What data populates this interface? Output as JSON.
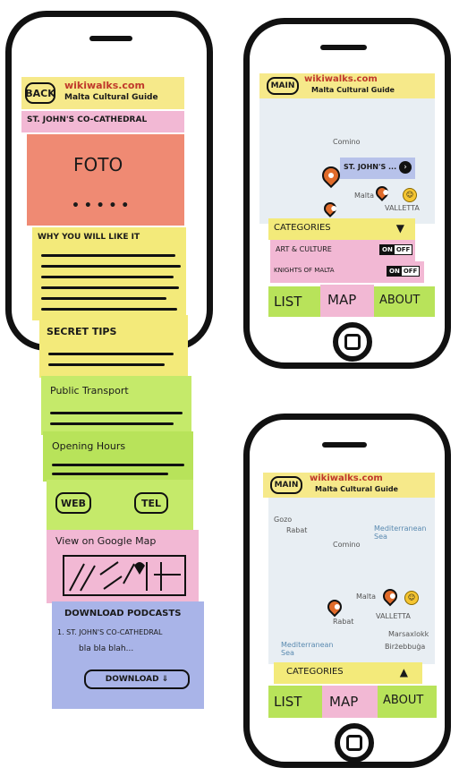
{
  "brand": {
    "name": "wikiwalks.com",
    "tagline": "Malta Cultural Guide"
  },
  "detail": {
    "back_label": "BACK",
    "place_title": "ST. JOHN'S CO-CATHEDRAL",
    "photo_label": "FOTO",
    "photo_dots": "• • • • •",
    "why_heading": "WHY YOU WILL LIKE IT",
    "secret_heading": "SECRET TIPS",
    "transport_heading": "Public Transport",
    "opening_heading": "Opening Hours",
    "web_label": "WEB",
    "tel_label": "TEL",
    "map_heading": "View on Google Map",
    "podcasts_heading": "DOWNLOAD PODCASTS",
    "podcast_item": "1. ST. JOHN'S CO-CATHEDRAL",
    "podcast_desc": "bla bla blah...",
    "download_label": "DOWNLOAD ⇓"
  },
  "map_screen_top": {
    "main_label": "MAIN",
    "callout_label": "ST. JOHN'S ...",
    "categories_label": "CATEGORIES",
    "categories_arrow": "▼",
    "filters": [
      {
        "label": "ART & CULTURE",
        "on": "ON",
        "off": "OFF"
      },
      {
        "label": "KNIGHTS OF MALTA",
        "on": "ON",
        "off": "OFF"
      }
    ],
    "map_labels": {
      "comino": "Comino",
      "malta": "Malta",
      "valletta": "VALLETTA"
    }
  },
  "map_screen_bottom": {
    "main_label": "MAIN",
    "categories_label": "CATEGORIES",
    "categories_arrow": "▲",
    "map_labels": {
      "gozo": "Gozo",
      "rabat": "Rabat",
      "comino": "Comino",
      "sea_top": "Mediterranean Sea",
      "malta": "Malta",
      "rabat2": "Rabat",
      "valletta": "VALLETTA",
      "sea_bottom": "Mediterranean Sea",
      "marsa": "Marsaxlokk",
      "birzebbuga": "Birżebbuġa"
    }
  },
  "tabs": [
    "LIST",
    "MAP",
    "ABOUT"
  ],
  "colors": {
    "yellow": "#f6e98a",
    "pink": "#f2b8d4",
    "salmon": "#ef8a73",
    "green": "#b8e35a",
    "blue": "#a9b4e8",
    "pin": "#e06b2a"
  }
}
